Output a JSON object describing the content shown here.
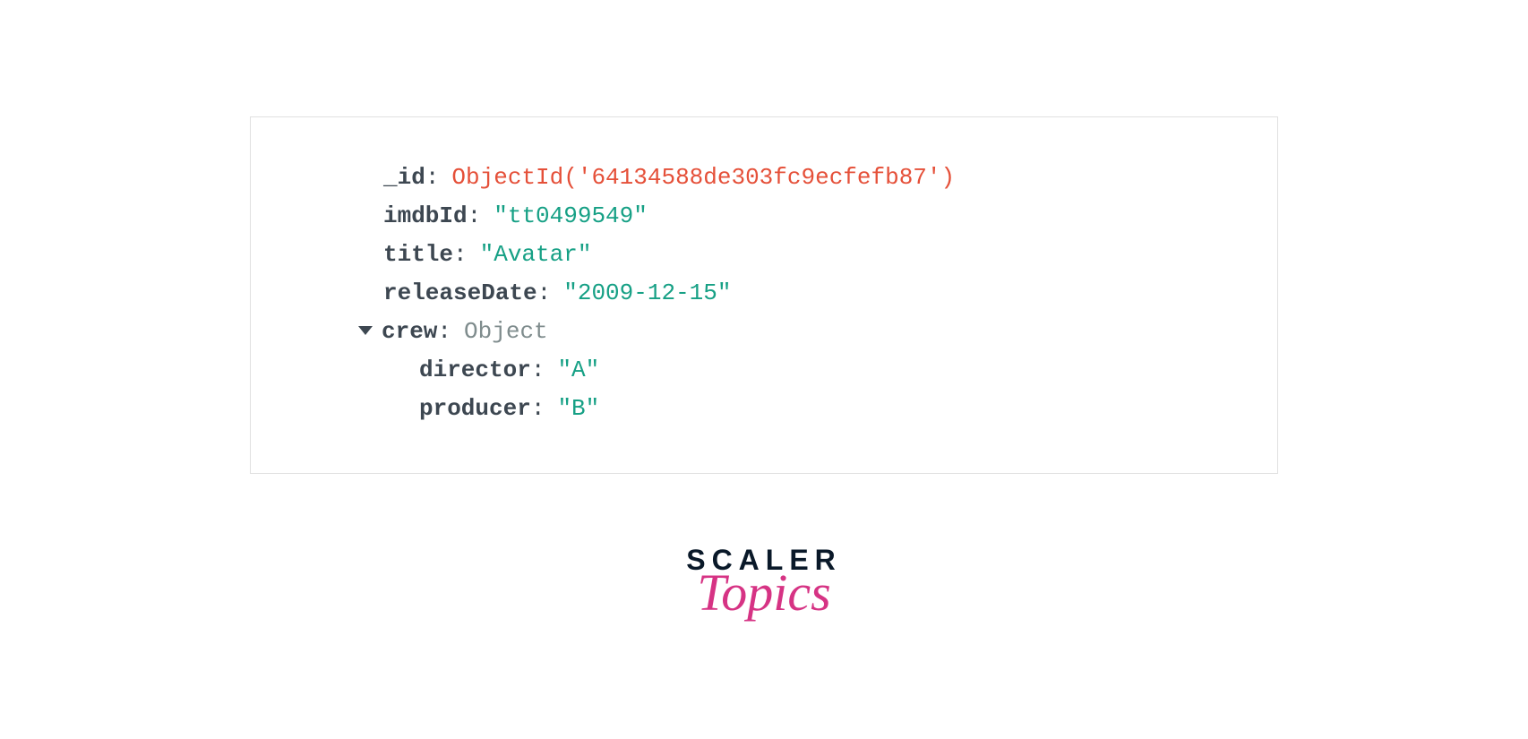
{
  "document": {
    "fields": [
      {
        "key": "_id",
        "value": "ObjectId('64134588de303fc9ecfefb87')",
        "type": "objectid",
        "indent": 0,
        "expandable": false
      },
      {
        "key": "imdbId",
        "value": "\"tt0499549\"",
        "type": "string",
        "indent": 0,
        "expandable": false
      },
      {
        "key": "title",
        "value": "\"Avatar\"",
        "type": "string",
        "indent": 0,
        "expandable": false
      },
      {
        "key": "releaseDate",
        "value": "\"2009-12-15\"",
        "type": "string",
        "indent": 0,
        "expandable": false
      },
      {
        "key": "crew",
        "value": "Object",
        "type": "type",
        "indent": 1,
        "expandable": true
      },
      {
        "key": "director",
        "value": "\"A\"",
        "type": "string",
        "indent": 2,
        "expandable": false
      },
      {
        "key": "producer",
        "value": "\"B\"",
        "type": "string",
        "indent": 2,
        "expandable": false
      }
    ]
  },
  "logo": {
    "line1": "SCALER",
    "line2": "Topics"
  }
}
